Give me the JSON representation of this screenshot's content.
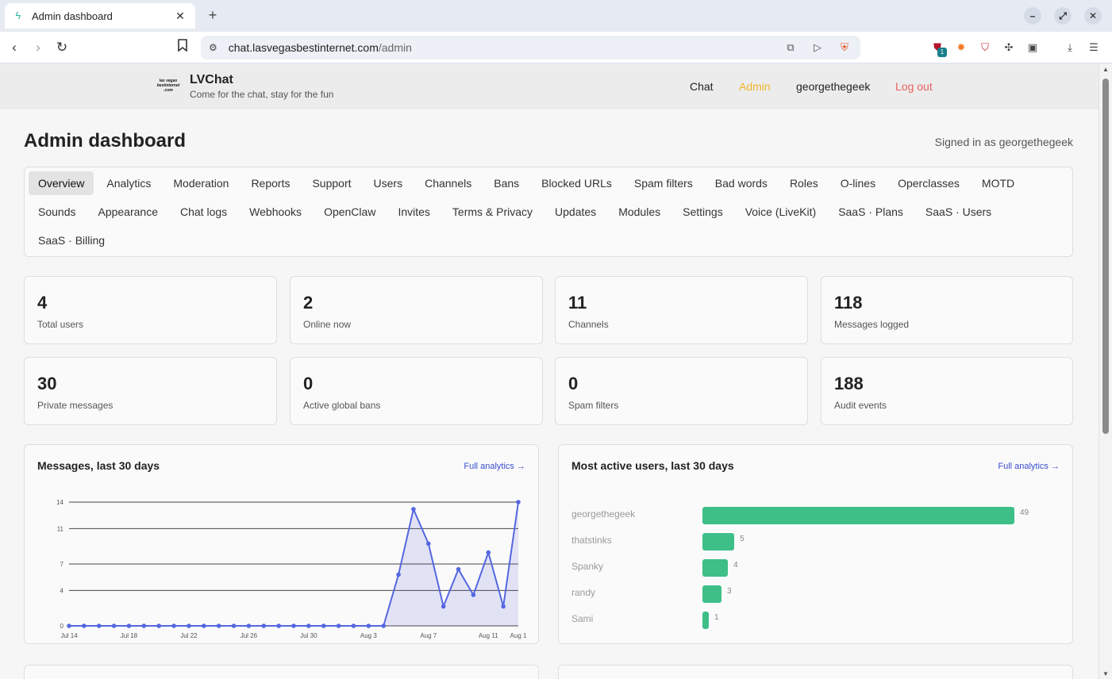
{
  "browser": {
    "tab_title": "Admin dashboard",
    "url_site": "chat.lasvegasbestinternet.com",
    "url_path": "/admin",
    "extension_badge": "1"
  },
  "site": {
    "logo_text": [
      "las vegas",
      "bestinternet",
      ".com"
    ],
    "brand_name": "LVChat",
    "tagline": "Come for the chat, stay for the fun",
    "nav": {
      "chat": "Chat",
      "admin": "Admin",
      "user": "georgethegeek",
      "logout": "Log out"
    },
    "colors": {
      "admin_active": "#f0b429",
      "logout": "#e8625f",
      "accent_link": "#3a4fd0",
      "bar": "#3dbf87",
      "line": "#5567e0"
    }
  },
  "dashboard": {
    "title": "Admin dashboard",
    "signed_in": "Signed in as georgethegeek",
    "tabs_row1": [
      "Overview",
      "Analytics",
      "Moderation",
      "Reports",
      "Support",
      "Users",
      "Channels",
      "Bans",
      "Blocked URLs",
      "Spam filters",
      "Bad words",
      "Roles",
      "O-lines",
      "Operclasses",
      "MOTD"
    ],
    "tabs_row2": [
      "Sounds",
      "Appearance",
      "Chat logs",
      "Webhooks",
      "OpenClaw",
      "Invites",
      "Terms & Privacy",
      "Updates",
      "Modules",
      "Settings",
      "Voice (LiveKit)",
      "SaaS · Plans",
      "SaaS · Users"
    ],
    "tabs_row3": [
      "SaaS · Billing"
    ],
    "active_tab": "Overview",
    "stats": [
      {
        "value": "4",
        "label": "Total users"
      },
      {
        "value": "2",
        "label": "Online now"
      },
      {
        "value": "11",
        "label": "Channels"
      },
      {
        "value": "118",
        "label": "Messages logged"
      },
      {
        "value": "30",
        "label": "Private messages"
      },
      {
        "value": "0",
        "label": "Active global bans"
      },
      {
        "value": "0",
        "label": "Spam filters"
      },
      {
        "value": "188",
        "label": "Audit events"
      }
    ],
    "messages_panel": {
      "title": "Messages, last 30 days",
      "link": "Full analytics →"
    },
    "users_panel": {
      "title": "Most active users, last 30 days",
      "link": "Full analytics →"
    }
  },
  "chart_data": [
    {
      "type": "area",
      "title": "Messages, last 30 days",
      "x_tick_labels": [
        "Jul 14",
        "Jul 18",
        "Jul 22",
        "Jul 26",
        "Jul 30",
        "Aug 3",
        "Aug 7",
        "Aug 11",
        "Aug 1"
      ],
      "y_ticks": [
        0,
        4,
        7,
        11,
        14
      ],
      "ylim": [
        0,
        14
      ],
      "grid": true,
      "values": [
        0,
        0,
        0,
        0,
        0,
        0,
        0,
        0,
        0,
        0,
        0,
        0,
        0,
        0,
        0,
        0,
        0,
        0,
        0,
        0,
        0,
        0,
        5.8,
        13.2,
        9.3,
        2.2,
        6.4,
        3.5,
        8.3,
        2.2,
        14
      ]
    },
    {
      "type": "bar",
      "orientation": "horizontal",
      "title": "Most active users, last 30 days",
      "categories": [
        "georgethegeek",
        "thatstinks",
        "Spanky",
        "randy",
        "Sami"
      ],
      "values": [
        49,
        5,
        4,
        3,
        1
      ]
    }
  ]
}
